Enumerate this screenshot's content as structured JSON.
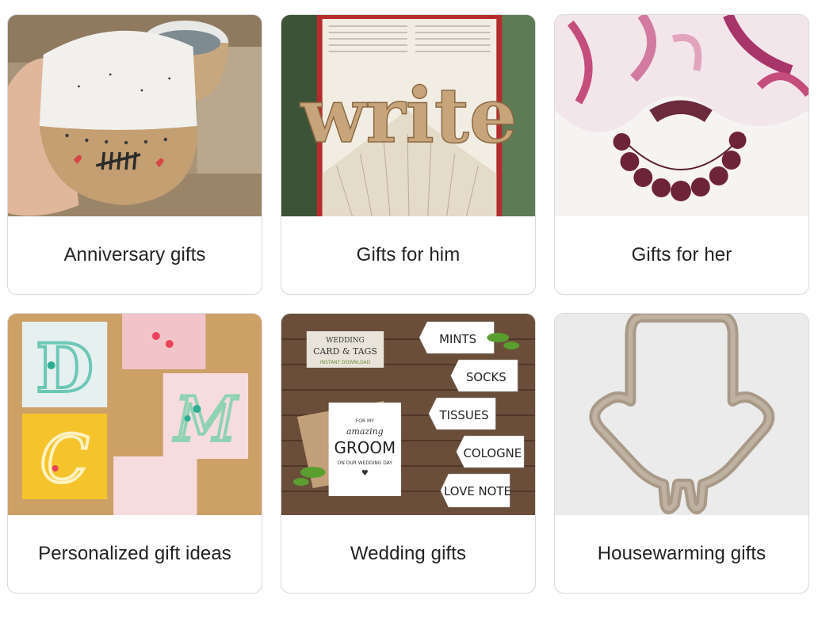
{
  "categories": [
    {
      "label": "Anniversary gifts",
      "image": "speckled ceramic cups with tally marks"
    },
    {
      "label": "Gifts for him",
      "image": "folded book art spelling word"
    },
    {
      "label": "Gifts for her",
      "image": "pink silk scarf with beaded necklace"
    },
    {
      "label": "Personalized gift ideas",
      "image": "quilled paper monogram letters"
    },
    {
      "label": "Wedding gifts",
      "image": "wedding card and gift tags on wood"
    },
    {
      "label": "Housewarming gifts",
      "image": "ceramic hamsa hand wall decor"
    }
  ],
  "image_text": {
    "book_word": "write",
    "wedding_header": [
      "WEDDING",
      "CARD & TAGS",
      "INSTANT DOWNLOAD"
    ],
    "card": [
      "FOR MY",
      "amazing",
      "GROOM",
      "ON OUR WEDDING DAY"
    ],
    "tags": [
      "MINTS",
      "SOCKS",
      "TISSUES",
      "COLOGNE",
      "LOVE NOTE"
    ]
  }
}
